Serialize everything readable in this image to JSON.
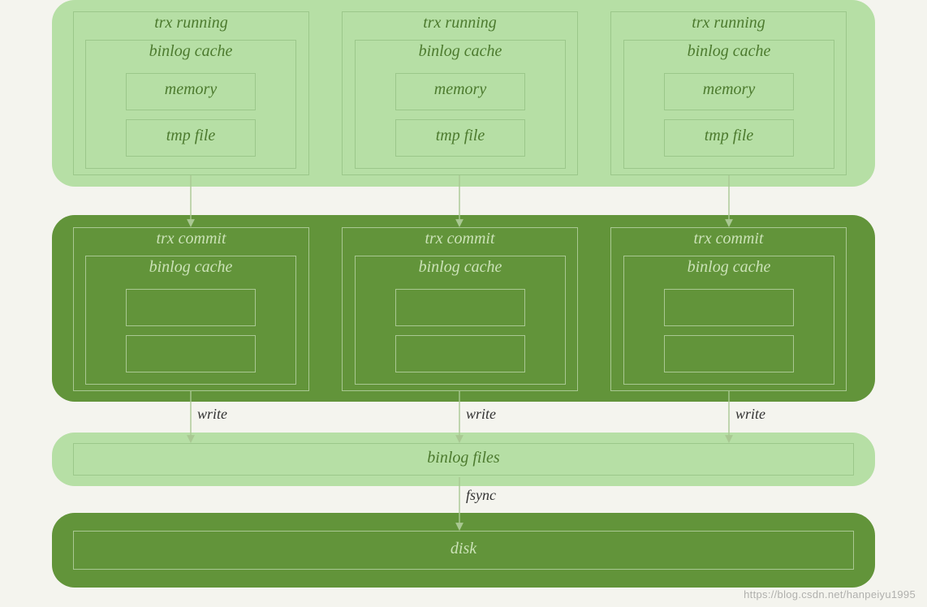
{
  "colors": {
    "light": "#b6dfa5",
    "dark": "#62943a"
  },
  "trx_running_title": "trx running",
  "binlog_cache_title": "binlog cache",
  "memory_label": "memory",
  "tmp_file_label": "tmp file",
  "trx_commit_title": "trx commit",
  "write_label": "write",
  "binlog_files_label": "binlog files",
  "fsync_label": "fsync",
  "disk_label": "disk",
  "watermark": "https://blog.csdn.net/hanpeiyu1995"
}
